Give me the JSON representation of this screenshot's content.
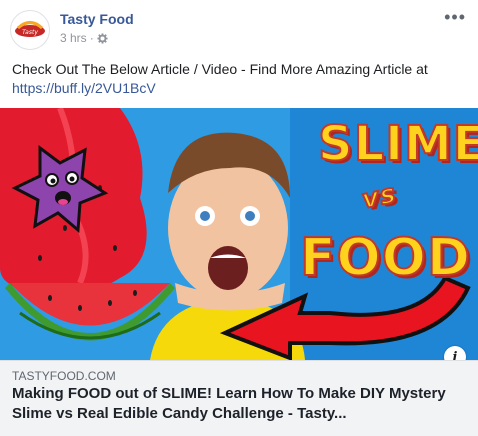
{
  "post": {
    "page_name": "Tasty Food",
    "time": "3 hrs",
    "separator": "·",
    "privacy_icon": "gear-icon",
    "more_label": "•••",
    "text": "Check Out The Below Article / Video - Find More Amazing Article at",
    "link_url": "https://buff.ly/2VU1BcV"
  },
  "media": {
    "title_top": "SLIME",
    "title_vs": "vs",
    "title_bottom": "FOOD",
    "info_label": "i"
  },
  "link_preview": {
    "domain": "TASTYFOOD.COM",
    "title": "Making FOOD out of SLIME! Learn How To Make DIY Mystery Slime vs Real Edible Candy Challenge - Tasty..."
  },
  "colors": {
    "link_blue": "#385898",
    "meta_gray": "#90949c",
    "preview_bg": "#f2f3f5",
    "slime_red": "#e21b2e",
    "title_yellow": "#ffd21e",
    "arrow_red": "#e8141f"
  }
}
